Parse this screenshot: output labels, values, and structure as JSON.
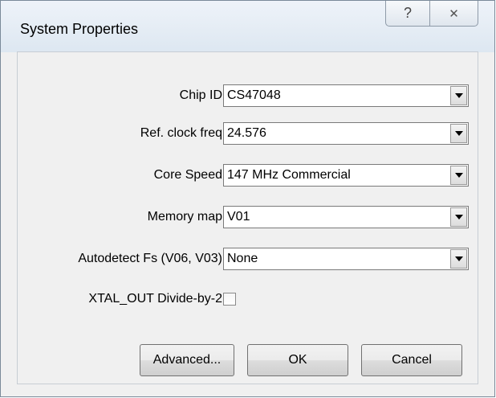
{
  "window": {
    "title": "System Properties",
    "help_glyph": "?",
    "close_glyph": "✕"
  },
  "fields": [
    {
      "label": "Chip ID",
      "value": "CS47048",
      "icon": "chevron-down-icon"
    },
    {
      "label": "Ref. clock freq",
      "value": "24.576",
      "icon": "chevron-down-icon"
    },
    {
      "label": "Core Speed",
      "value": "147 MHz Commercial",
      "icon": "chevron-down-icon"
    },
    {
      "label": "Memory map",
      "value": "V01",
      "icon": "chevron-down-icon"
    },
    {
      "label": "Autodetect Fs (V06, V03)",
      "value": "None",
      "icon": "chevron-down-icon"
    }
  ],
  "xtal": {
    "label": "XTAL_OUT Divide-by-2",
    "checked": false
  },
  "buttons": {
    "advanced": "Advanced...",
    "ok": "OK",
    "cancel": "Cancel"
  },
  "colors": {
    "window_bg": "#f0f0f0",
    "titlebar": "#dde7f1",
    "border": "#7a8a99"
  }
}
